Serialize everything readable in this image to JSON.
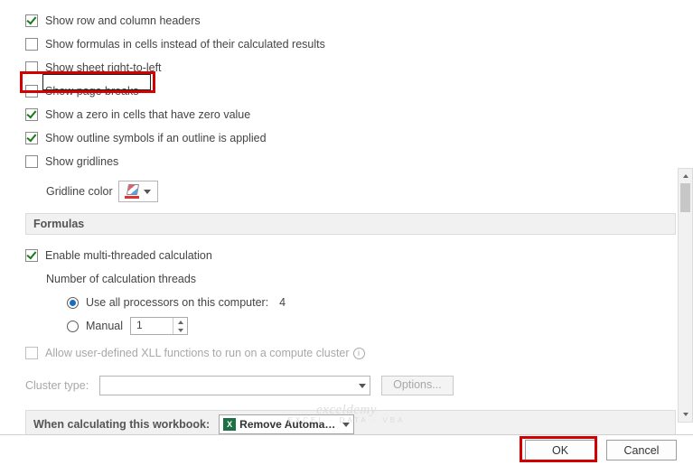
{
  "display": {
    "show_headers": "Show row and column headers",
    "show_formulas": "Show formulas in cells instead of their calculated results",
    "show_rtl": "Show sheet right-to-left",
    "show_page_breaks": "Show page breaks",
    "show_zero": "Show a zero in cells that have zero value",
    "show_outline": "Show outline symbols if an outline is applied",
    "show_gridlines": "Show gridlines",
    "gridline_color_label": "Gridline color"
  },
  "formulas": {
    "heading": "Formulas",
    "enable_multi": "Enable multi-threaded calculation",
    "num_threads_label": "Number of calculation threads",
    "use_all_label": "Use all processors on this computer:",
    "processor_count": "4",
    "manual_label": "Manual",
    "manual_value": "1",
    "allow_xll": "Allow user-defined XLL functions to run on a compute cluster",
    "cluster_type_label": "Cluster type:",
    "options_btn": "Options..."
  },
  "workbook": {
    "label": "When calculating this workbook:",
    "name": "Remove Automatic..."
  },
  "footer": {
    "ok": "OK",
    "cancel": "Cancel"
  },
  "watermark": {
    "main": "exceldemy",
    "sub": "EXCEL · DATA · VBA"
  }
}
